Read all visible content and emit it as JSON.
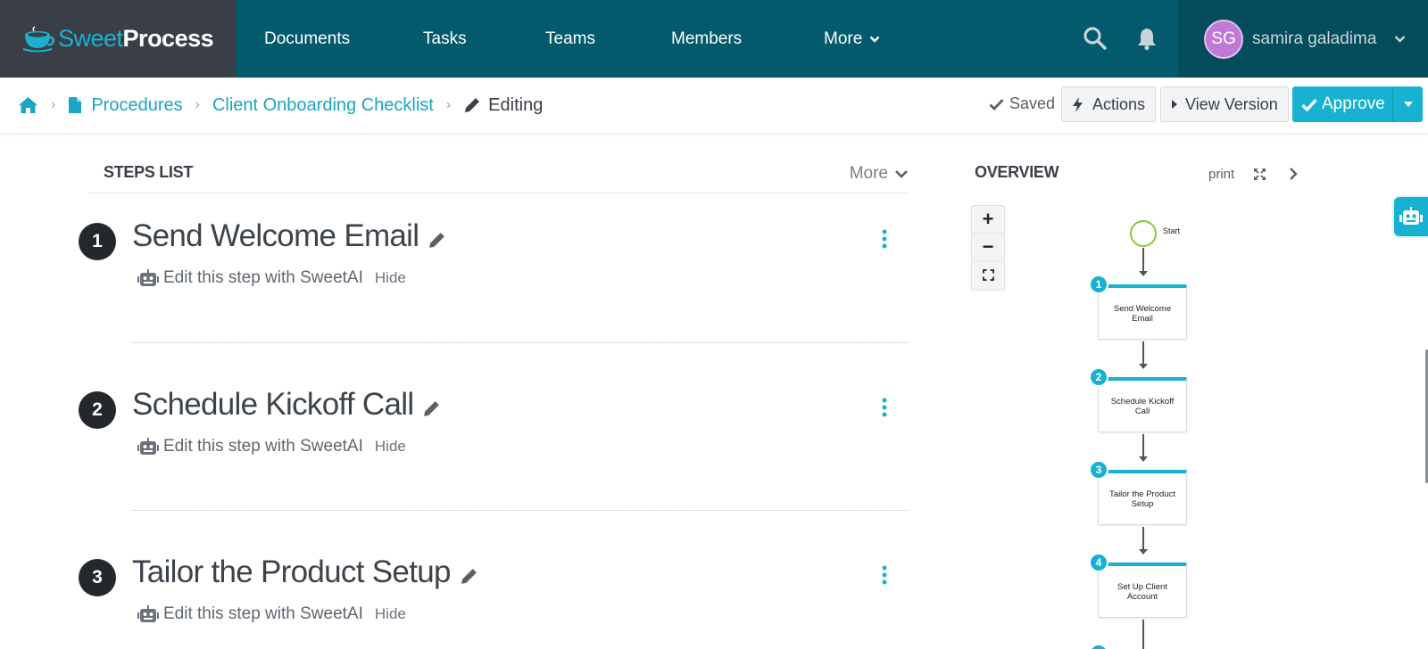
{
  "brand": {
    "sweet": "Sweet",
    "process": "Process"
  },
  "nav": {
    "documents": "Documents",
    "tasks": "Tasks",
    "teams": "Teams",
    "members": "Members",
    "more": "More"
  },
  "user": {
    "initials": "SG",
    "name": "samira galadima"
  },
  "breadcrumb": {
    "procedures": "Procedures",
    "document": "Client Onboarding Checklist",
    "current": "Editing"
  },
  "toolbar": {
    "saved": "Saved",
    "actions": "Actions",
    "view_version": "View Version",
    "approve": "Approve"
  },
  "steps_list": {
    "title": "STEPS LIST",
    "more": "More",
    "steps": [
      {
        "number": "1",
        "title": "Send Welcome Email",
        "ai_text": "Edit this step with SweetAI",
        "hide": "Hide"
      },
      {
        "number": "2",
        "title": "Schedule Kickoff Call",
        "ai_text": "Edit this step with SweetAI",
        "hide": "Hide"
      },
      {
        "number": "3",
        "title": "Tailor the Product Setup",
        "ai_text": "Edit this step with SweetAI",
        "hide": "Hide"
      }
    ]
  },
  "overview": {
    "title": "OVERVIEW",
    "print": "print",
    "zoom_in": "+",
    "zoom_out": "−",
    "start": "Start",
    "nodes": [
      {
        "number": "1",
        "label": "Send Welcome Email"
      },
      {
        "number": "2",
        "label": "Schedule Kickoff Call"
      },
      {
        "number": "3",
        "label": "Tailor the Product Setup"
      },
      {
        "number": "4",
        "label": "Set Up Client Account"
      }
    ]
  },
  "colors": {
    "nav_bg": "#035a6c",
    "logo_bg": "#3a3e46",
    "accent": "#17b2d1",
    "avatar": "#c079d6",
    "start_node": "#8cc63f"
  }
}
